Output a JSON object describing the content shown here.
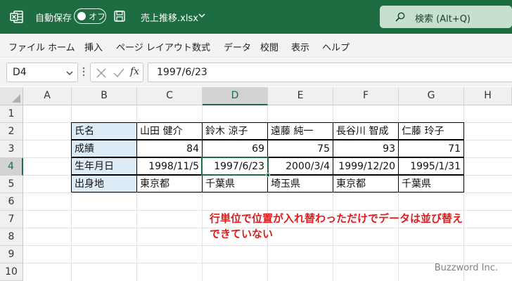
{
  "titlebar": {
    "autosave_label": "自動保存",
    "autosave_state": "オフ",
    "filename": "売上推移.xlsx",
    "search_text": "検索 (Alt+Q)",
    "accent": "#1e6c41"
  },
  "menu": [
    "ファイル",
    "ホーム",
    "挿入",
    "ページ レイアウト",
    "数式",
    "データ",
    "校閲",
    "表示",
    "ヘルプ"
  ],
  "formula_bar": {
    "name_box": "D4",
    "fx_label": "fx",
    "formula": "1997/6/23"
  },
  "sheet": {
    "columns": [
      "A",
      "B",
      "C",
      "D",
      "E",
      "F",
      "G",
      "H"
    ],
    "rows": [
      "1",
      "2",
      "3",
      "4",
      "5",
      "6",
      "7",
      "8",
      "9",
      "10"
    ],
    "selected_cell": "D4",
    "table": {
      "labels": [
        "氏名",
        "成績",
        "生年月日",
        "出身地"
      ],
      "names": [
        "山田 健介",
        "鈴木 涼子",
        "遠藤 純一",
        "長谷川 智成",
        "仁藤 玲子"
      ],
      "scores": [
        "84",
        "69",
        "75",
        "93",
        "71"
      ],
      "birthdays": [
        "1998/11/5",
        "1997/6/23",
        "2000/3/4",
        "1999/12/20",
        "1995/1/31"
      ],
      "birthplaces": [
        "東京都",
        "千葉県",
        "埼玉県",
        "東京都",
        "千葉県"
      ]
    },
    "note_line1": "行単位で位置が入れ替わっただけでデータは並び替え",
    "note_line2": "できていない",
    "note_color": "#e01b1b"
  },
  "watermark": "Buzzword Inc."
}
